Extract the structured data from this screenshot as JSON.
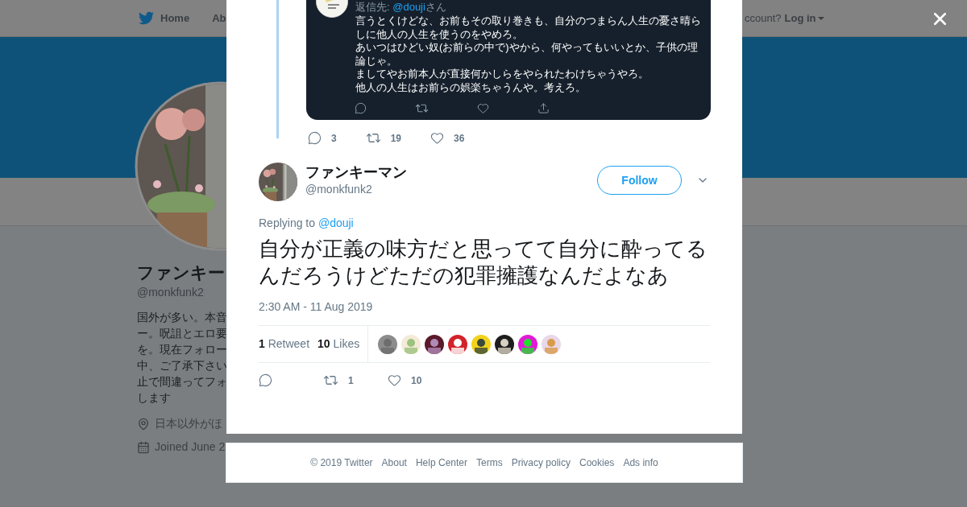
{
  "background_page": {
    "nav": {
      "items": [
        {
          "label": "Home"
        },
        {
          "label": "Ab"
        }
      ],
      "account_prompt": "ccount?",
      "login": "Log in"
    },
    "profile": {
      "name": "ファンキー",
      "handle": "@monkfunk2",
      "bio_lines": [
        "国外が多い。本音",
        "ー。呪詛とエロ要",
        "を。現在フォロー",
        "中、ご了承下さい",
        "止で間違ってフォ",
        "します"
      ],
      "location": "日本以外がほ",
      "joined": "Joined June 2"
    }
  },
  "modal": {
    "quoted_tweet": {
      "reply_prefix": "返信先: ",
      "reply_handle": "@douji",
      "reply_suffix": "さん",
      "paragraphs": [
        "言うとくけどな、お前もその取り巻きも、自分のつまらん人生の憂さ晴らしに他人の人生を使うのをやめろ。",
        "あいつはひどい奴(お前らの中で)やから、何やってもいいとか、子供の理論じゃ。",
        "ましてやお前本人が直接何かしらをやられたわけちゃうやろ。",
        "他人の人生はお前らの娯楽ちゃうんや。考えろ。"
      ],
      "actions": [
        {
          "kind": "reply",
          "count": "3"
        },
        {
          "kind": "retweet",
          "count": "19"
        },
        {
          "kind": "like",
          "count": "36"
        }
      ]
    },
    "tweet": {
      "name": "ファンキーマン",
      "handle": "@monkfunk2",
      "follow_button": "Follow",
      "replying_label": "Replying to",
      "replying_handle": "@douji",
      "text": "自分が正義の味方だと思ってて自分に酔ってるんだろうけどただの犯罪擁護なんだよなあ",
      "timestamp": "2:30 AM - 11 Aug 2019",
      "stats": [
        {
          "count": "1",
          "label": "Retweet"
        },
        {
          "count": "10",
          "label": "Likes"
        }
      ],
      "actions": [
        {
          "kind": "reply"
        },
        {
          "kind": "retweet",
          "count": "1"
        },
        {
          "kind": "like",
          "count": "10"
        }
      ]
    }
  },
  "footer": {
    "links": [
      "© 2019 Twitter",
      "About",
      "Help Center",
      "Terms",
      "Privacy policy",
      "Cookies",
      "Ads info"
    ]
  }
}
